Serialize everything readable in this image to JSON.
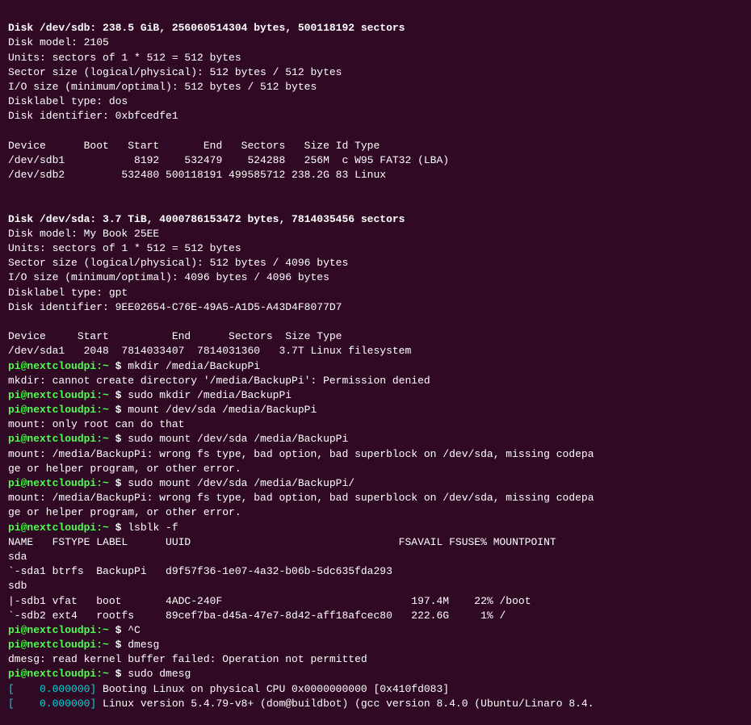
{
  "terminal": {
    "lines": [
      {
        "type": "bold-white",
        "text": "Disk /dev/sdb: 238.5 GiB, 256060514304 bytes, 500118192 sectors"
      },
      {
        "type": "normal",
        "text": "Disk model: 2105"
      },
      {
        "type": "normal",
        "text": "Units: sectors of 1 * 512 = 512 bytes"
      },
      {
        "type": "normal",
        "text": "Sector size (logical/physical): 512 bytes / 512 bytes"
      },
      {
        "type": "normal",
        "text": "I/O size (minimum/optimal): 512 bytes / 512 bytes"
      },
      {
        "type": "normal",
        "text": "Disklabel type: dos"
      },
      {
        "type": "normal",
        "text": "Disk identifier: 0xbfcedfe1"
      },
      {
        "type": "blank",
        "text": ""
      },
      {
        "type": "normal",
        "text": "Device      Boot   Start       End   Sectors   Size Id Type"
      },
      {
        "type": "normal",
        "text": "/dev/sdb1           8192    532479    524288   256M  c W95 FAT32 (LBA)"
      },
      {
        "type": "normal",
        "text": "/dev/sdb2         532480 500118191 499585712 238.2G 83 Linux"
      },
      {
        "type": "blank",
        "text": ""
      },
      {
        "type": "blank",
        "text": ""
      },
      {
        "type": "bold-white",
        "text": "Disk /dev/sda: 3.7 TiB, 4000786153472 bytes, 7814035456 sectors"
      },
      {
        "type": "normal",
        "text": "Disk model: My Book 25EE"
      },
      {
        "type": "normal",
        "text": "Units: sectors of 1 * 512 = 512 bytes"
      },
      {
        "type": "normal",
        "text": "Sector size (logical/physical): 512 bytes / 4096 bytes"
      },
      {
        "type": "normal",
        "text": "I/O size (minimum/optimal): 4096 bytes / 4096 bytes"
      },
      {
        "type": "normal",
        "text": "Disklabel type: gpt"
      },
      {
        "type": "normal",
        "text": "Disk identifier: 9EE02654-C76E-49A5-A1D5-A43D4F8077D7"
      },
      {
        "type": "blank",
        "text": ""
      },
      {
        "type": "normal",
        "text": "Device     Start          End      Sectors  Size Type"
      },
      {
        "type": "normal",
        "text": "/dev/sda1   2048  7814033407  7814031360   3.7T Linux filesystem"
      },
      {
        "type": "prompt-line",
        "prompt": "pi@nextcloudpi:~",
        "command": " mkdir /media/BackupPi"
      },
      {
        "type": "error",
        "text": "mkdir: cannot create directory '/media/BackupPi': Permission denied"
      },
      {
        "type": "prompt-line",
        "prompt": "pi@nextcloudpi:~",
        "command": " sudo mkdir /media/BackupPi"
      },
      {
        "type": "prompt-line",
        "prompt": "pi@nextcloudpi:~",
        "command": " mount /dev/sda /media/BackupPi"
      },
      {
        "type": "error",
        "text": "mount: only root can do that"
      },
      {
        "type": "prompt-line",
        "prompt": "pi@nextcloudpi:~",
        "command": " sudo mount /dev/sda /media/BackupPi"
      },
      {
        "type": "error",
        "text": "mount: /media/BackupPi: wrong fs type, bad option, bad superblock on /dev/sda, missing codepa"
      },
      {
        "type": "error-cont",
        "text": "ge or helper program, or other error."
      },
      {
        "type": "prompt-line",
        "prompt": "pi@nextcloudpi:~",
        "command": " sudo mount /dev/sda /media/BackupPi/"
      },
      {
        "type": "error",
        "text": "mount: /media/BackupPi: wrong fs type, bad option, bad superblock on /dev/sda, missing codepa"
      },
      {
        "type": "error-cont",
        "text": "ge or helper program, or other error."
      },
      {
        "type": "prompt-line",
        "prompt": "pi@nextcloudpi:~",
        "command": " lsblk -f"
      },
      {
        "type": "normal",
        "text": "NAME   FSTYPE LABEL      UUID                                 FSAVAIL FSUSE% MOUNTPOINT"
      },
      {
        "type": "normal",
        "text": "sda"
      },
      {
        "type": "normal",
        "text": "`-sda1 btrfs  BackupPi   d9f57f36-1e07-4a32-b06b-5dc635fda293"
      },
      {
        "type": "normal",
        "text": "sdb"
      },
      {
        "type": "normal",
        "text": "|-sdb1 vfat   boot       4ADC-240F                              197.4M    22% /boot"
      },
      {
        "type": "normal",
        "text": "`-sdb2 ext4   rootfs     89cef7ba-d45a-47e7-8d42-aff18afcec80   222.6G     1% /"
      },
      {
        "type": "prompt-line",
        "prompt": "pi@nextcloudpi:~",
        "command": " ^C"
      },
      {
        "type": "prompt-line",
        "prompt": "pi@nextcloudpi:~",
        "command": " dmesg"
      },
      {
        "type": "error",
        "text": "dmesg: read kernel buffer failed: Operation not permitted"
      },
      {
        "type": "prompt-line",
        "prompt": "pi@nextcloudpi:~",
        "command": " sudo dmesg"
      },
      {
        "type": "dmesg",
        "time": "0.000000",
        "text": "Booting Linux on physical CPU 0x0000000000 [0x410fd083]"
      },
      {
        "type": "dmesg",
        "time": "0.000000",
        "text": "Linux version 5.4.79-v8+ (dom@buildbot) (gcc version 8.4.0 (Ubuntu/Linaro 8.4."
      }
    ]
  }
}
